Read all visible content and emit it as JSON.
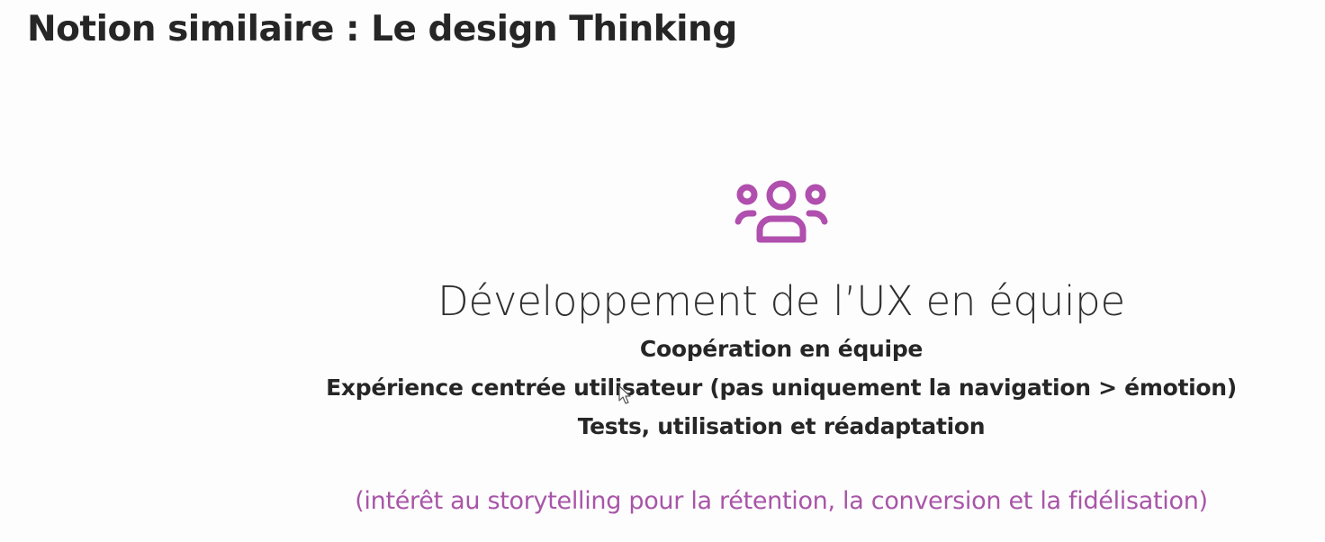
{
  "slide": {
    "title": "Notion similaire : Le design Thinking",
    "icon": "team-users-icon",
    "heading": "Développement de l’UX en équipe",
    "points": [
      "Coopération en équipe",
      "Expérience centrée utilisateur (pas uniquement la navigation > émotion)",
      "Tests, utilisation et réadaptation"
    ],
    "note": "(intérêt au storytelling pour la rétention, la conversion et la fidélisation)"
  },
  "colors": {
    "accent": "#a855a8",
    "text": "#262626",
    "background": "#fdfdfd"
  }
}
